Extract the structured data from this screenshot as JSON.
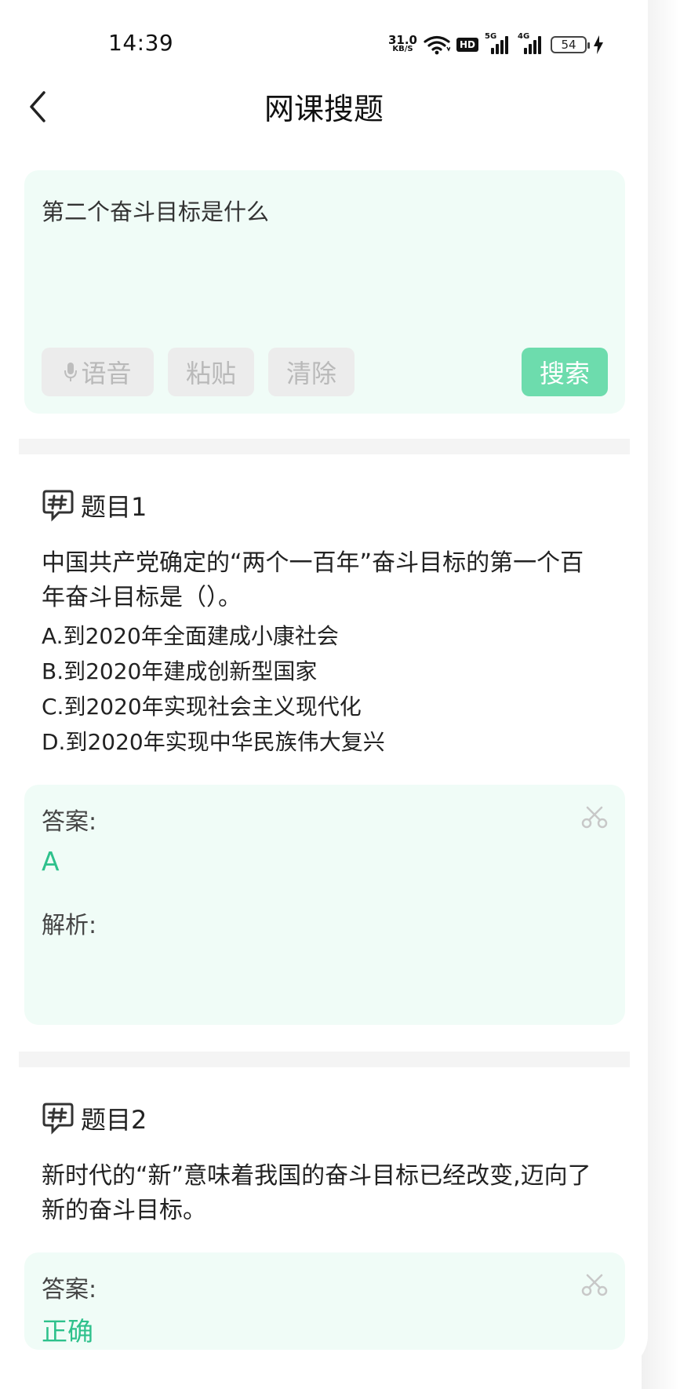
{
  "status_bar": {
    "time": "14:39",
    "net_speed_value": "31.0",
    "net_speed_unit": "KB/S",
    "hd_badge": "HD",
    "signal_1_label": "5G",
    "signal_2_label": "4G",
    "battery_level": "54"
  },
  "header": {
    "title": "网课搜题",
    "back_icon": "chevron-left-icon"
  },
  "search": {
    "query": "第二个奋斗目标是什么",
    "voice_label": "语音",
    "paste_label": "粘贴",
    "clear_label": "清除",
    "search_label": "搜索",
    "accent": "#6ddcad"
  },
  "questions": [
    {
      "label": "题目1",
      "text": "中国共产党确定的“两个一百年”奋斗目标的第一个百年奋斗目标是（）。",
      "options": [
        "A.到2020年全面建成小康社会",
        "B.到2020年建成创新型国家",
        "C.到2020年实现社会主义现代化",
        "D.到2020年实现中华民族伟大复兴"
      ],
      "answer_label": "答案:",
      "answer": "A",
      "analysis_label": "解析:"
    },
    {
      "label": "题目2",
      "text": "新时代的“新”意味着我国的奋斗目标已经改变,迈向了新的奋斗目标。",
      "answer_label": "答案:",
      "answer": "正确"
    }
  ],
  "colors": {
    "card_bg": "#f0fcf7",
    "answer_text": "#2ec18c",
    "button_disabled_bg": "#ececec"
  }
}
